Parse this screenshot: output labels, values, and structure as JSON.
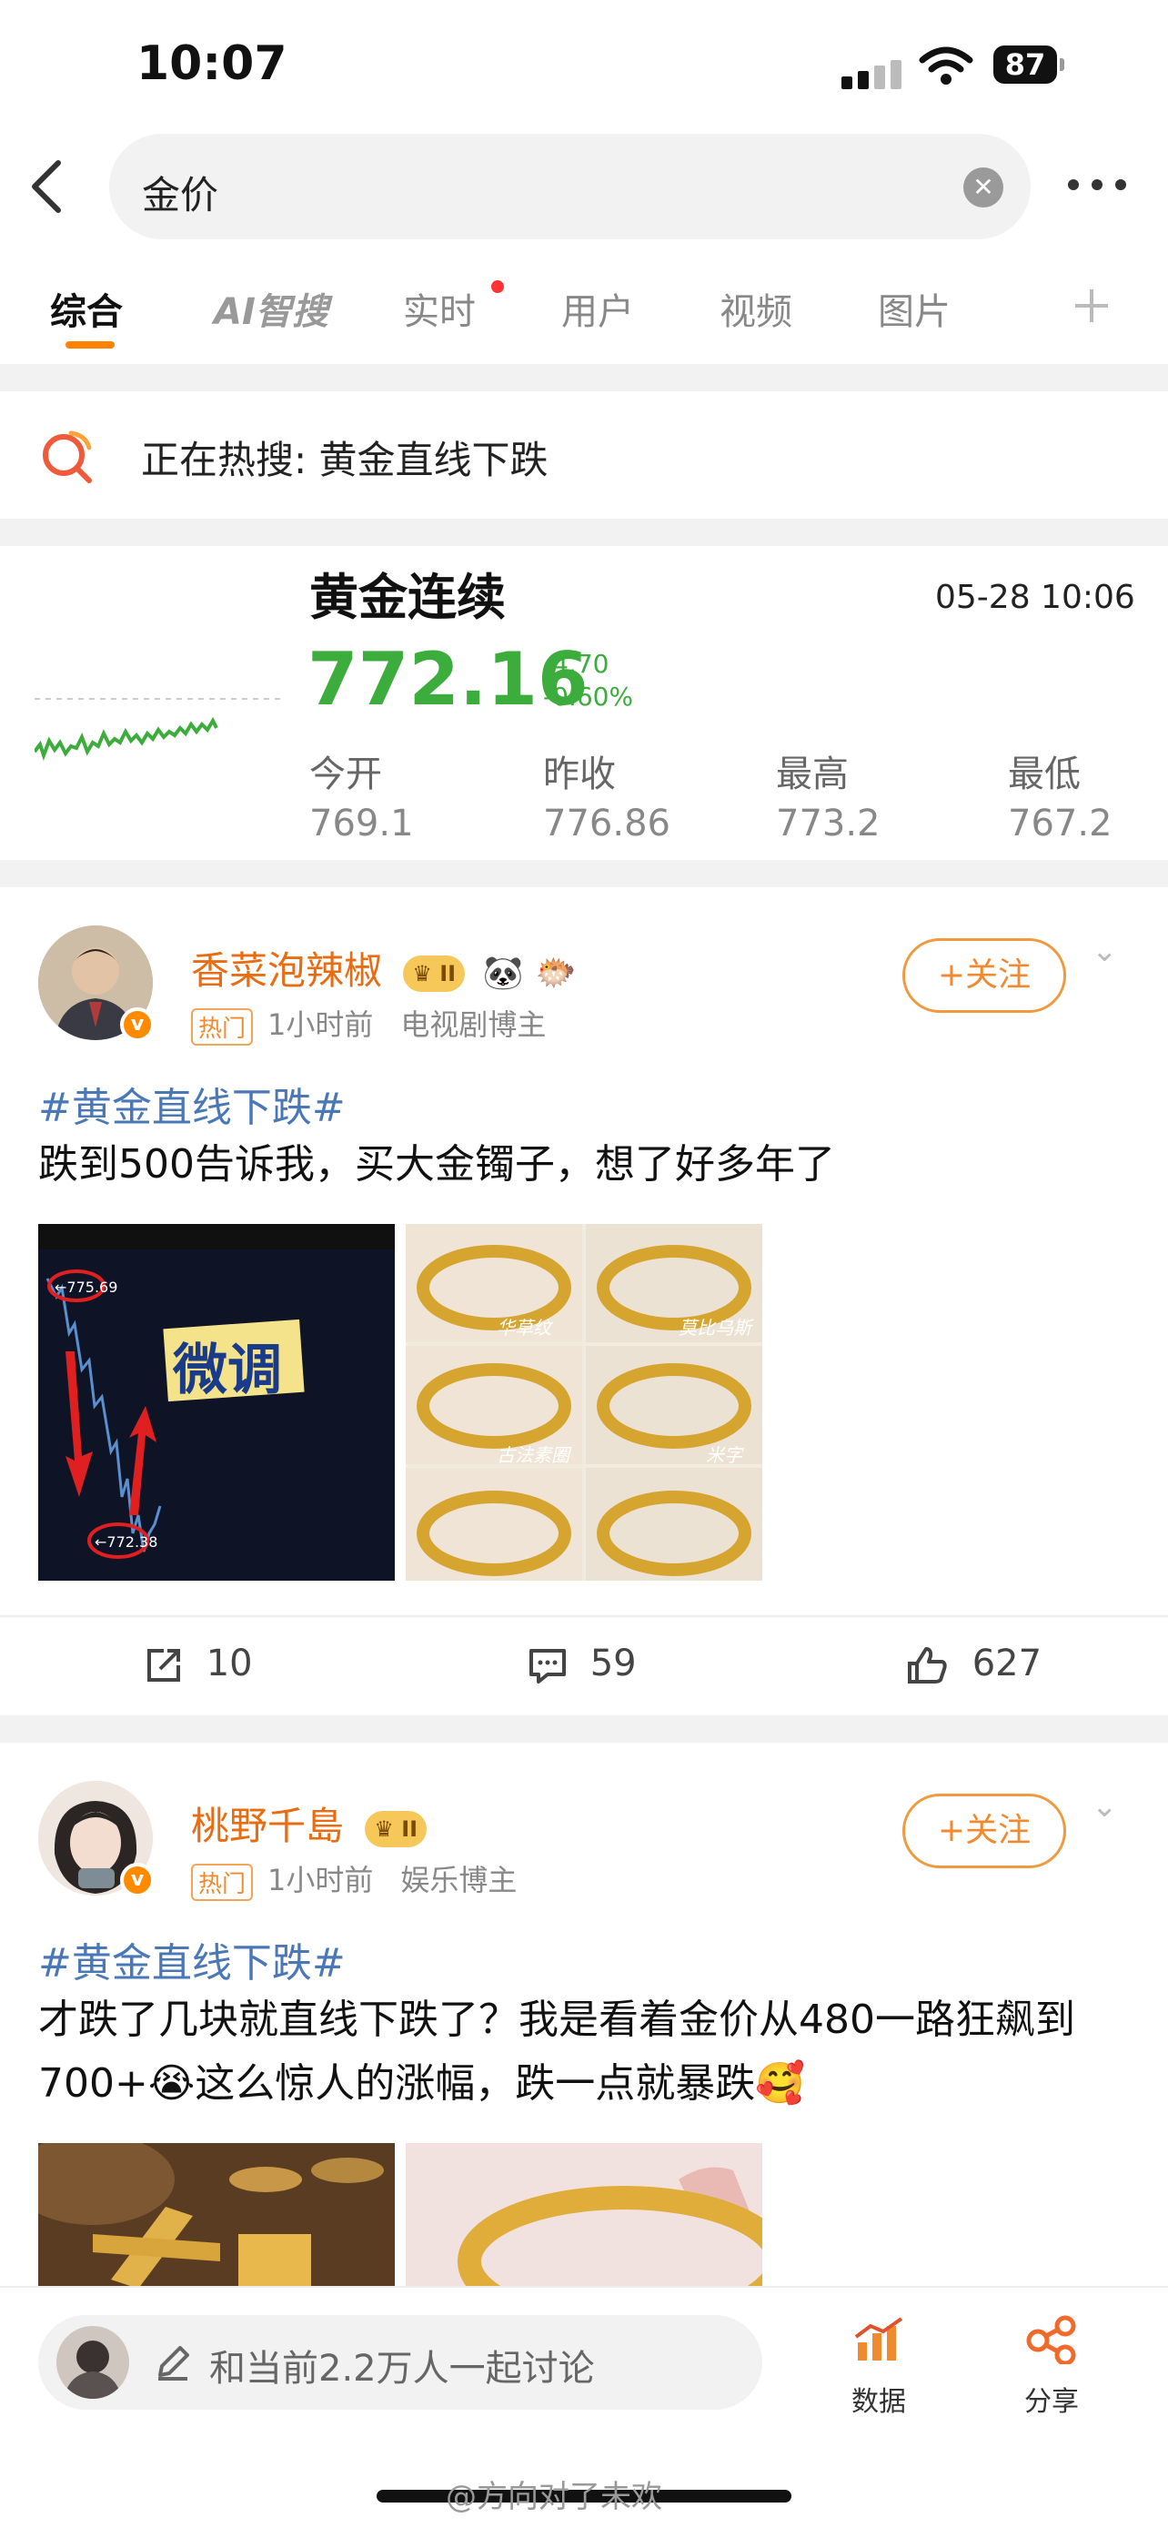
{
  "status_bar": {
    "time": "10:07",
    "battery": "87"
  },
  "search": {
    "query": "金价"
  },
  "tabs": [
    {
      "label": "综合"
    },
    {
      "label": "AI智搜"
    },
    {
      "label": "实时"
    },
    {
      "label": "用户"
    },
    {
      "label": "视频"
    },
    {
      "label": "图片"
    }
  ],
  "hot_search": {
    "text": "正在热搜: 黄金直线下跌"
  },
  "stock": {
    "title": "黄金连续",
    "datetime": "05-28 10:06",
    "price": "772.16",
    "change": "-4.70",
    "change_pct": "-0.60%",
    "stats": [
      {
        "label": "今开",
        "value": "769.1"
      },
      {
        "label": "昨收",
        "value": "776.86"
      },
      {
        "label": "最高",
        "value": "773.2"
      },
      {
        "label": "最低",
        "value": "767.2"
      }
    ],
    "colors": {
      "down": "#3cac3c"
    }
  },
  "posts": [
    {
      "username": "香菜泡辣椒",
      "vip": "II",
      "hot_badge": "热门",
      "time": "1小时前",
      "category": "电视剧博主",
      "follow_label": "+关注",
      "hashtag": "#黄金直线下跌#",
      "text": "跌到500告诉我，买大金镯子，想了好多年了",
      "image1": {
        "caption": "微调",
        "label_top": "←775.69",
        "label_bottom": "←772.38"
      },
      "image2": {
        "captions": [
          "华草纹",
          "莫比乌斯",
          "古法素圈",
          "米字"
        ]
      },
      "reposts": "10",
      "comments": "59",
      "likes": "627"
    },
    {
      "username": "桃野千島",
      "vip": "II",
      "hot_badge": "热门",
      "time": "1小时前",
      "category": "娱乐博主",
      "follow_label": "+关注",
      "hashtag": "#黄金直线下跌#",
      "text": "才跌了几块就直线下跌了？我是看着金价从480一路狂飙到700+😭这么惊人的涨幅，跌一点就暴跌🥰"
    }
  ],
  "bottom_bar": {
    "input_placeholder": "和当前2.2万人一起讨论",
    "data_label": "数据",
    "share_label": "分享"
  },
  "watermark": "@方向对了未欢"
}
